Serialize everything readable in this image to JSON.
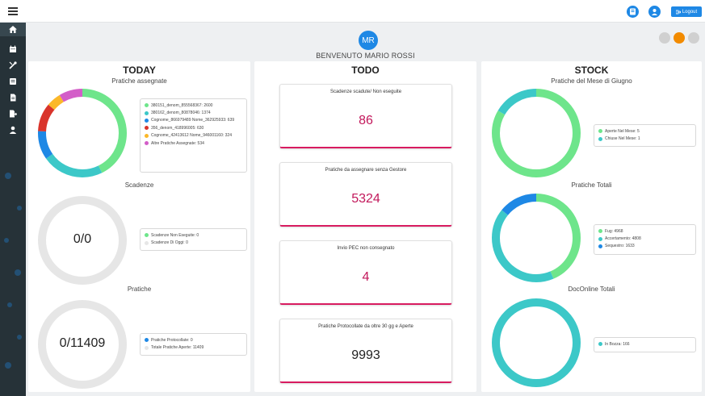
{
  "topbar": {
    "logout_label": "Logout"
  },
  "header": {
    "avatar_initials": "MR",
    "welcome": "BENVENUTO MARIO ROSSI"
  },
  "today": {
    "title": "TODAY",
    "assigned": {
      "title": "Pratiche assegnate",
      "segments": [
        {
          "label": "380151_denom_855568367: 2600",
          "value": 2600,
          "color": "#6ee58b"
        },
        {
          "label": "380162_denom_80878046: 1374",
          "value": 1374,
          "color": "#3cc8c8"
        },
        {
          "label": "Cognome_866979489 Nome_362925933: 639",
          "value": 639,
          "color": "#1e88e5"
        },
        {
          "label": "356_denom_418996005: 630",
          "value": 630,
          "color": "#d9342b"
        },
        {
          "label": "Cognome_42413612 Nome_946001160: 324",
          "value": 324,
          "color": "#fbb829"
        },
        {
          "label": "Altre Pratiche Assegnate: 534",
          "value": 534,
          "color": "#d35ec8"
        }
      ]
    },
    "deadlines": {
      "title": "Scadenze",
      "center": "0/0",
      "legend": [
        {
          "label": "Scadenze Non Eseguite: 0",
          "color": "#6ee58b"
        },
        {
          "label": "Scadenze Di Oggi: 0",
          "color": "#e6e6e6"
        }
      ]
    },
    "practices": {
      "title": "Pratiche",
      "center": "0/11409",
      "legend": [
        {
          "label": "Pratiche Protocollate: 0",
          "color": "#1e88e5"
        },
        {
          "label": "Totale Pratiche Aperte: 11409",
          "color": "#e6e6e6"
        }
      ]
    }
  },
  "todo": {
    "title": "TODO",
    "cards": [
      {
        "title": "Scadenze scadute/ Non eseguite",
        "value": "86",
        "color": "#c2185b"
      },
      {
        "title": "Pratiche da assegnare senza Gestore",
        "value": "5324",
        "color": "#c2185b"
      },
      {
        "title": "Invio PEC non consegnato",
        "value": "4",
        "color": "#c2185b"
      },
      {
        "title": "Pratiche Protocollate da oltre 30 gg e Aperte",
        "value": "9993",
        "color": "#222222"
      }
    ]
  },
  "stock": {
    "title": "STOCK",
    "month": {
      "title": "Pratiche del Mese di Giugno",
      "segments": [
        {
          "label": "Aperte Nel Mese: 5",
          "value": 5,
          "color": "#6ee58b"
        },
        {
          "label": "Chiuse Nel Mese: 1",
          "value": 1,
          "color": "#3cc8c8"
        }
      ]
    },
    "totals": {
      "title": "Pratiche Totali",
      "segments": [
        {
          "label": "Fug: 4968",
          "value": 4968,
          "color": "#6ee58b"
        },
        {
          "label": "Accertamento: 4808",
          "value": 4808,
          "color": "#3cc8c8"
        },
        {
          "label": "Sequestro: 1633",
          "value": 1633,
          "color": "#1e88e5"
        }
      ]
    },
    "docs": {
      "title": "DocOnline Totali",
      "segments": [
        {
          "label": "In Bozza: 166",
          "value": 166,
          "color": "#3cc8c8"
        }
      ]
    }
  }
}
